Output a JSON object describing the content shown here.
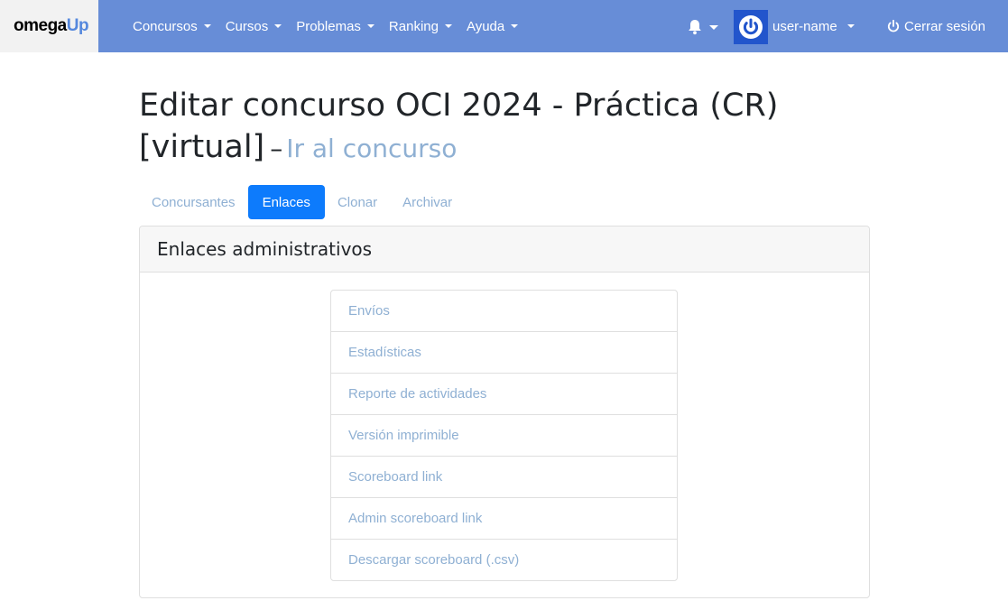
{
  "navbar": {
    "brand_part1": "omega",
    "brand_part2": "Up",
    "menu": [
      {
        "label": "Concursos"
      },
      {
        "label": "Cursos"
      },
      {
        "label": "Problemas"
      },
      {
        "label": "Ranking"
      },
      {
        "label": "Ayuda"
      }
    ],
    "notifications_icon": "bell-icon",
    "avatar_icon": "power-icon",
    "user_name": "user-name",
    "logout_label": "Cerrar sesión",
    "logout_icon": "power-icon"
  },
  "page": {
    "title": "Editar concurso OCI 2024 - Práctica (CR) [virtual]",
    "separator": "–",
    "contest_link": "Ir al concurso"
  },
  "tabs": [
    {
      "label": "Concursantes",
      "active": false
    },
    {
      "label": "Enlaces",
      "active": true
    },
    {
      "label": "Clonar",
      "active": false
    },
    {
      "label": "Archivar",
      "active": false
    }
  ],
  "card": {
    "title": "Enlaces administrativos",
    "links": [
      {
        "label": "Envíos"
      },
      {
        "label": "Estadísticas"
      },
      {
        "label": "Reporte de actividades"
      },
      {
        "label": "Versión imprimible"
      },
      {
        "label": "Scoreboard link"
      },
      {
        "label": "Admin scoreboard link"
      },
      {
        "label": "Descargar scoreboard (.csv)"
      }
    ]
  },
  "colors": {
    "navbar": "#678dd7",
    "accent": "#0d7bfc",
    "link": "#8fb0d3"
  }
}
